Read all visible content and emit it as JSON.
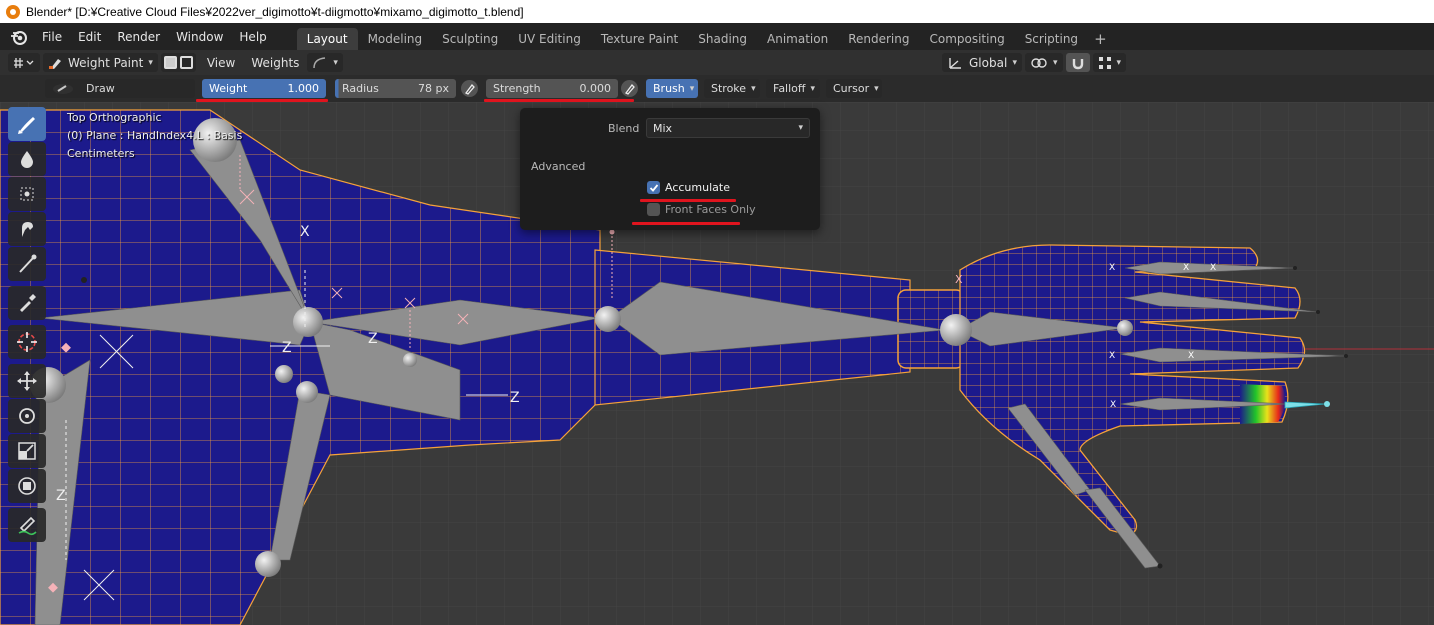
{
  "window": {
    "title": "Blender* [D:¥Creative Cloud Files¥2022ver_digimotto¥t-diigmotto¥mixamo_digimotto_t.blend]"
  },
  "menu": {
    "items": [
      "File",
      "Edit",
      "Render",
      "Window",
      "Help"
    ]
  },
  "workspaces": {
    "tabs": [
      "Layout",
      "Modeling",
      "Sculpting",
      "UV Editing",
      "Texture Paint",
      "Shading",
      "Animation",
      "Rendering",
      "Compositing",
      "Scripting"
    ],
    "active": "Layout",
    "add_label": "+"
  },
  "header": {
    "mode": "Weight Paint",
    "view": "View",
    "weights": "Weights",
    "orientation": "Global"
  },
  "tool_settings": {
    "brush_name": "Draw",
    "weight": {
      "label": "Weight",
      "value": "1.000"
    },
    "radius": {
      "label": "Radius",
      "value": "78 px"
    },
    "strength": {
      "label": "Strength",
      "value": "0.000"
    },
    "dropdowns": {
      "brush": "Brush",
      "stroke": "Stroke",
      "falloff": "Falloff",
      "cursor": "Cursor"
    }
  },
  "viewport_info": {
    "view_name": "Top Orthographic",
    "object_info": "(0) Plane : HandIndex4.L : Basis",
    "units": "Centimeters"
  },
  "brush_popover": {
    "blend_label": "Blend",
    "blend_value": "Mix",
    "advanced_label": "Advanced",
    "accumulate_label": "Accumulate",
    "accumulate_checked": true,
    "front_faces_label": "Front Faces Only",
    "front_faces_checked": false
  },
  "bone_axis_labels": [
    "X",
    "X",
    "X",
    "X",
    "X",
    "X",
    "X",
    "X",
    "Z",
    "Z",
    "Z",
    "Z"
  ],
  "colors": {
    "accent": "#4772b3",
    "highlight_red": "#e0141e",
    "mesh_blue": "#1c1a8c",
    "wire_orange": "#f5a23a",
    "bone_gray": "#8a8a8a"
  },
  "toolbar_icons": [
    "draw-brush-icon",
    "blur-icon",
    "average-icon",
    "smear-icon",
    "gradient-icon",
    "sample-weight-icon",
    "cursor-icon",
    "move-icon",
    "rotate-icon",
    "scale-icon",
    "transform-icon",
    "annotate-icon"
  ]
}
